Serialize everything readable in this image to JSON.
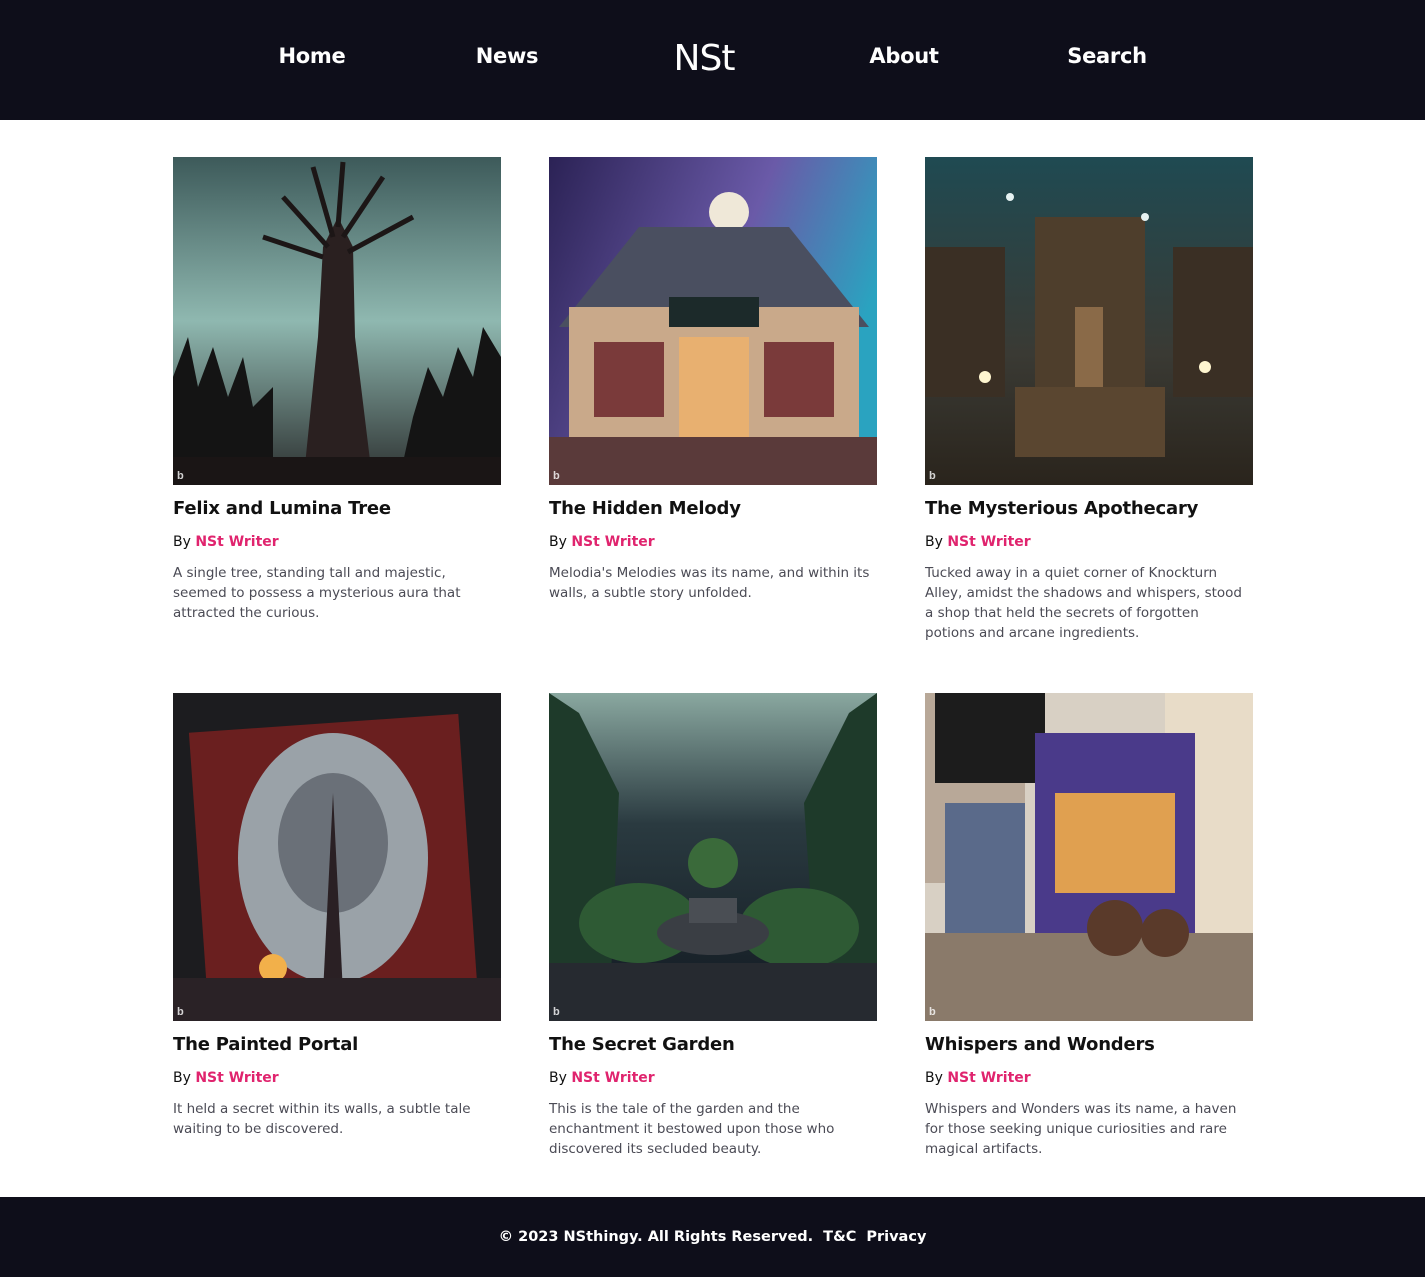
{
  "header": {
    "logo": "NSt",
    "nav": [
      "Home",
      "News",
      "About",
      "Search"
    ]
  },
  "posts": [
    {
      "title": "Felix and Lumina Tree",
      "by": "By",
      "author": "NSt Writer",
      "excerpt": "A single tree, standing tall and majestic, seemed to possess a mysterious aura that attracted the curious.",
      "image_icon": "tree-image"
    },
    {
      "title": "The Hidden Melody",
      "by": "By",
      "author": "NSt Writer",
      "excerpt": "Melodia's Melodies was its name, and within its walls, a subtle story unfolded.",
      "image_icon": "shop-image"
    },
    {
      "title": "The Mysterious Apothecary",
      "by": "By",
      "author": "NSt Writer",
      "excerpt": "Tucked away in a quiet corner of Knockturn Alley, amidst the shadows and whispers, stood a shop that held the secrets of forgotten potions and arcane ingredients.",
      "image_icon": "apothecary-image"
    },
    {
      "title": "The Painted Portal",
      "by": "By",
      "author": "NSt Writer",
      "excerpt": "It held a secret within its walls, a subtle tale waiting to be discovered.",
      "image_icon": "portal-image"
    },
    {
      "title": "The Secret Garden",
      "by": "By",
      "author": "NSt Writer",
      "excerpt": "This is the tale of the garden and the enchantment it bestowed upon those who discovered its secluded beauty.",
      "image_icon": "garden-image"
    },
    {
      "title": "Whispers and Wonders",
      "by": "By",
      "author": "NSt Writer",
      "excerpt": "Whispers and Wonders was its name, a haven for those seeking unique curiosities and rare magical artifacts.",
      "image_icon": "storefront-image"
    }
  ],
  "footer": {
    "copyright": "© 2023 NSthingy. All Rights Reserved.",
    "terms": "T&C",
    "privacy": "Privacy"
  },
  "colors": {
    "header_bg": "#0e0e1a",
    "author_accent": "#e0246e"
  }
}
